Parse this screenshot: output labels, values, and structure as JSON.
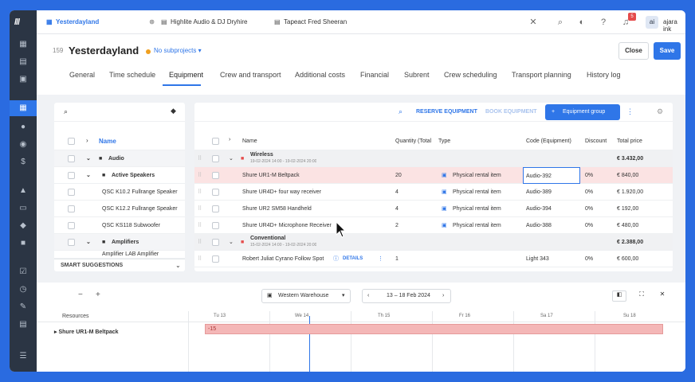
{
  "topbar": {
    "tabs": [
      {
        "label": "Yesterdayland",
        "active": true
      },
      {
        "label": "Highlite Audio & DJ Dryhire",
        "active": false
      },
      {
        "label": "Tapeact Fred Sheeran",
        "active": false
      }
    ],
    "notification_count": "5",
    "avatar_initials": "ai",
    "user_name": "ajara ink"
  },
  "project": {
    "number": "159",
    "title": "Yesterdayland",
    "subproject": "No subprojects",
    "close_label": "Close",
    "save_label": "Save"
  },
  "nav_tabs": [
    "General",
    "Time schedule",
    "Equipment",
    "Crew and transport",
    "Additional costs",
    "Financial",
    "Subrent",
    "Crew scheduling",
    "Transport planning",
    "History log"
  ],
  "left_panel": {
    "name_header": "Name",
    "rows": [
      {
        "label": "Audio",
        "level": 0,
        "group": true
      },
      {
        "label": "Active Speakers",
        "level": 1,
        "group": true
      },
      {
        "label": "QSC K10.2 Fullrange Speaker",
        "level": 2,
        "group": false
      },
      {
        "label": "QSC K12.2 Fullrange Speaker",
        "level": 2,
        "group": false
      },
      {
        "label": "QSC KS118 Subwoofer",
        "level": 2,
        "group": false
      },
      {
        "label": "Amplifiers",
        "level": 1,
        "group": true
      },
      {
        "label": "Amplifier LAB Amplifier",
        "level": 2,
        "group": false
      }
    ],
    "smart_suggestions": "SMART SUGGESTIONS"
  },
  "right_panel": {
    "reserve_label": "RESERVE EQUIPMENT",
    "book_label": "BOOK EQUIPMENT",
    "group_button": "Equipment group",
    "headers": {
      "name": "Name",
      "quantity": "Quantity (Total",
      "type": "Type",
      "code": "Code (Equipment)",
      "discount": "Discount",
      "total": "Total price"
    },
    "rows": [
      {
        "kind": "group",
        "name": "Wireless",
        "dates": "19-02-2024 14:00 - 19-02-2024 20:00",
        "total": "€ 3.432,00"
      },
      {
        "kind": "item",
        "name": "Shure UR1-M Beltpack",
        "qty": "20",
        "type": "Physical rental item",
        "code": "Audio-392",
        "discount": "0%",
        "total": "€ 840,00",
        "selected": true
      },
      {
        "kind": "item",
        "name": "Shure UR4D+ four way receiver",
        "qty": "4",
        "type": "Physical rental item",
        "code": "Audio-389",
        "discount": "0%",
        "total": "€ 1.920,00"
      },
      {
        "kind": "item",
        "name": "Shure UR2 SM58 Handheld",
        "qty": "4",
        "type": "Physical rental item",
        "code": "Audio-394",
        "discount": "0%",
        "total": "€ 192,00"
      },
      {
        "kind": "item",
        "name": "Shure UR4D+ Microphone Receiver",
        "qty": "2",
        "type": "Physical rental item",
        "code": "Audio-388",
        "discount": "0%",
        "total": "€ 480,00"
      },
      {
        "kind": "group",
        "name": "Conventional",
        "dates": "15-02-2024 14:00 - 19-02-2024 20:00",
        "total": "€ 2.388,00"
      },
      {
        "kind": "item",
        "name": "Robert Juliat Cyrano Follow Spot",
        "details": "DETAILS",
        "qty": "1",
        "type": "",
        "code": "Light 343",
        "discount": "0%",
        "total": "€ 600,00"
      }
    ]
  },
  "planner": {
    "warehouse": "Western Warehouse",
    "date_range": "13 – 18 Feb 2024",
    "resources_label": "Resources",
    "days": [
      "Tu 13",
      "We 14",
      "Th 15",
      "Fr 16",
      "Sa 17",
      "Su 18"
    ],
    "resource_row": "Shure UR1-M Beltpack",
    "bar_value": "-15"
  }
}
